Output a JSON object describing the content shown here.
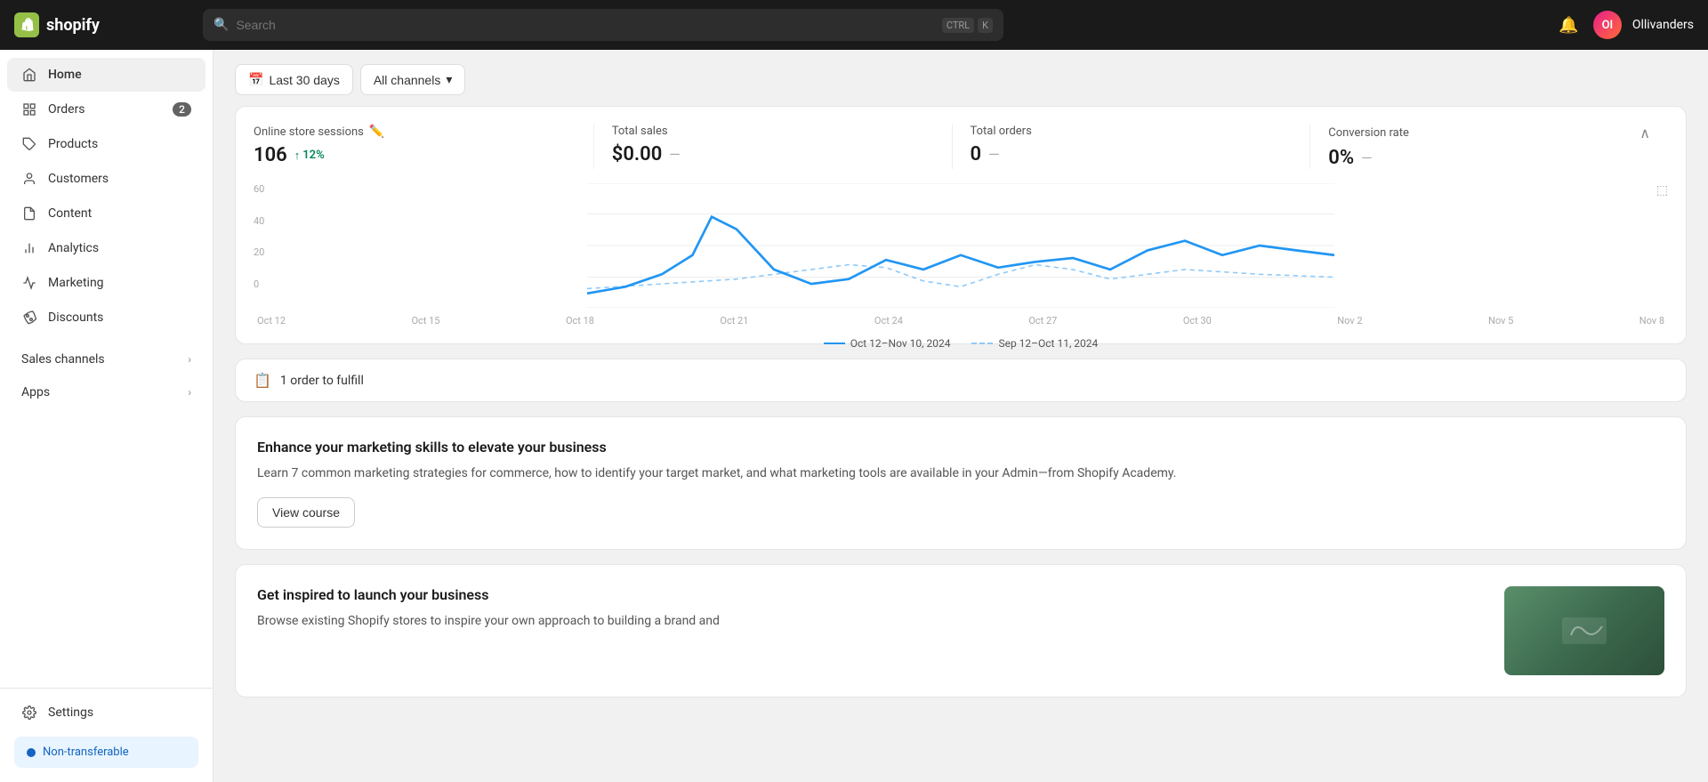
{
  "topbar": {
    "logo_text": "shopify",
    "search_placeholder": "Search",
    "search_shortcut_1": "CTRL",
    "search_shortcut_2": "K",
    "notification_icon": "🔔",
    "avatar_initials": "Ol",
    "store_name": "Ollivanders"
  },
  "sidebar": {
    "items": [
      {
        "id": "home",
        "label": "Home",
        "icon": "⌂",
        "badge": null,
        "active": true
      },
      {
        "id": "orders",
        "label": "Orders",
        "icon": "📦",
        "badge": "2",
        "active": false
      },
      {
        "id": "products",
        "label": "Products",
        "icon": "🏷",
        "badge": null,
        "active": false
      },
      {
        "id": "customers",
        "label": "Customers",
        "icon": "👤",
        "badge": null,
        "active": false
      },
      {
        "id": "content",
        "label": "Content",
        "icon": "📄",
        "badge": null,
        "active": false
      },
      {
        "id": "analytics",
        "label": "Analytics",
        "icon": "📊",
        "badge": null,
        "active": false
      },
      {
        "id": "marketing",
        "label": "Marketing",
        "icon": "📣",
        "badge": null,
        "active": false
      },
      {
        "id": "discounts",
        "label": "Discounts",
        "icon": "🏷",
        "badge": null,
        "active": false
      }
    ],
    "sections": [
      {
        "id": "sales-channels",
        "label": "Sales channels"
      },
      {
        "id": "apps",
        "label": "Apps"
      }
    ],
    "settings_label": "Settings",
    "non_transferable_label": "Non-transferable"
  },
  "filters": {
    "date_range": "Last 30 days",
    "channel": "All channels"
  },
  "stats": {
    "online_store_sessions": {
      "label": "Online store sessions",
      "value": "106",
      "change": "12%",
      "change_direction": "up"
    },
    "total_sales": {
      "label": "Total sales",
      "value": "$0.00"
    },
    "total_orders": {
      "label": "Total orders",
      "value": "0"
    },
    "conversion_rate": {
      "label": "Conversion rate",
      "value": "0%"
    }
  },
  "chart": {
    "y_labels": [
      "60",
      "40",
      "20",
      "0"
    ],
    "x_labels": [
      "Oct 12",
      "Oct 15",
      "Oct 18",
      "Oct 21",
      "Oct 24",
      "Oct 27",
      "Oct 30",
      "Nov 2",
      "Nov 5",
      "Nov 8"
    ],
    "legend": {
      "solid_label": "Oct 12–Nov 10, 2024",
      "dashed_label": "Sep 12–Oct 11, 2024"
    }
  },
  "order_fulfill": {
    "label": "1 order to fulfill"
  },
  "marketing_card": {
    "title": "Enhance your marketing skills to elevate your business",
    "description": "Learn 7 common marketing strategies for commerce, how to identify your target market, and what marketing tools are available in your Admin—from Shopify Academy.",
    "cta_label": "View course"
  },
  "inspire_card": {
    "title": "Get inspired to launch your business",
    "description": "Browse existing Shopify stores to inspire your own approach to building a brand and"
  }
}
